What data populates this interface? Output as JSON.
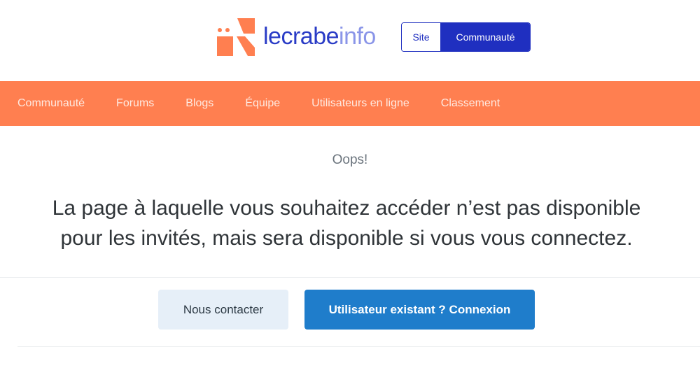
{
  "brand": {
    "logo_icon": "crab-logo-icon",
    "name_part1": "lecrabe",
    "name_part2": "info",
    "colors": {
      "logo": "#ff7f50",
      "primary": "#2a3cc6",
      "secondary": "#8a95e8"
    }
  },
  "switcher": {
    "site_label": "Site",
    "community_label": "Communauté",
    "active": "Communauté"
  },
  "nav": {
    "background": "#ff7f50",
    "items": [
      "Communauté",
      "Forums",
      "Blogs",
      "Équipe",
      "Utilisateurs en ligne",
      "Classement"
    ]
  },
  "content": {
    "oops": "Oops!",
    "message_line1": "La page à laquelle vous souhaitez accéder n’est pas disponible",
    "message_line2": "pour les invités, mais sera disponible si vous vous connectez."
  },
  "actions": {
    "contact_label": "Nous contacter",
    "login_label": "Utilisateur existant ? Connexion"
  }
}
